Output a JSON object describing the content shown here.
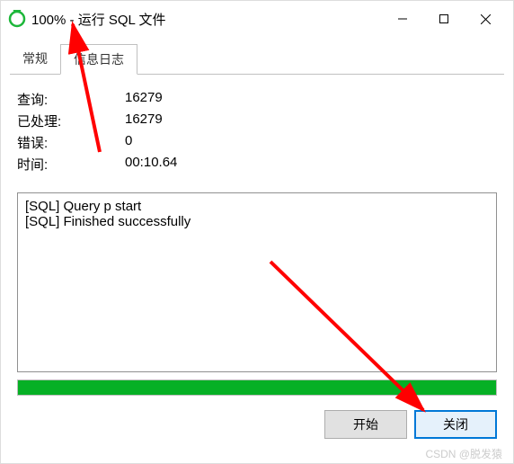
{
  "titlebar": {
    "title": "100% - 运行 SQL 文件",
    "icon": "navicat-icon"
  },
  "tabs": {
    "items": [
      {
        "label": "常规",
        "active": false
      },
      {
        "label": "信息日志",
        "active": true
      }
    ]
  },
  "stats": {
    "query_label": "查询:",
    "query_value": "16279",
    "processed_label": "已处理:",
    "processed_value": "16279",
    "errors_label": "错误:",
    "errors_value": "0",
    "time_label": "时间:",
    "time_value": "00:10.64"
  },
  "log": {
    "lines": [
      "[SQL] Query p start",
      "[SQL] Finished successfully"
    ]
  },
  "progress": {
    "percent": 100
  },
  "buttons": {
    "start": "开始",
    "close": "关闭"
  },
  "watermark": "CSDN @脱发猿"
}
